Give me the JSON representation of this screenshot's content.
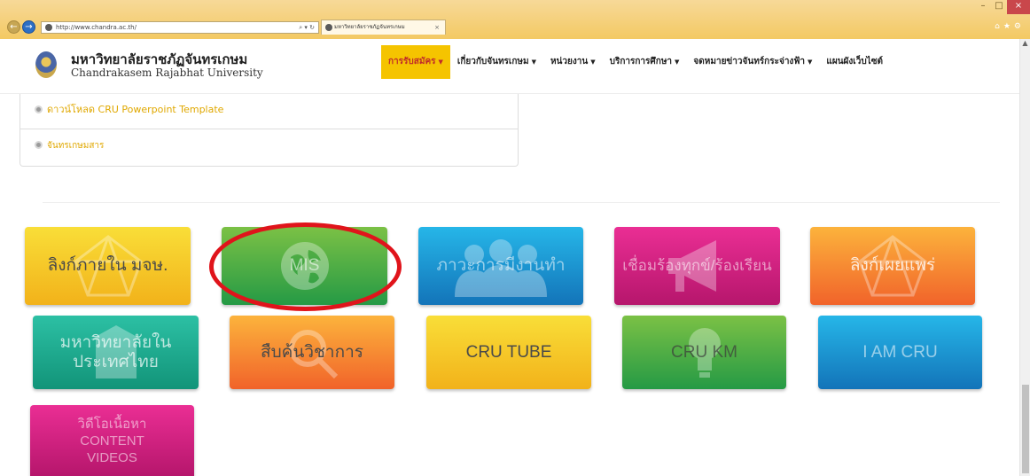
{
  "browser": {
    "url": "http://www.chandra.ac.th/",
    "address_tools": "⌕ ▾ ↻",
    "tab_title": "มหาวิทยาลัยราชภัฏจันทรเกษม",
    "tab_close": "×",
    "minimize": "–",
    "maximize": "□",
    "close": "×",
    "toolbar_icons": "⌂★⚙"
  },
  "header": {
    "brand_th": "มหาวิทยาลัยราชภัฏจันทรเกษม",
    "brand_en": "Chandrakasem Rajabhat University",
    "menu": [
      {
        "label": "การรับสมัคร",
        "caret": "▼"
      },
      {
        "label": "เกี่ยวกับจันทรเกษม",
        "caret": "▼"
      },
      {
        "label": "หน่วยงาน",
        "caret": "▼"
      },
      {
        "label": "บริการการศึกษา",
        "caret": "▼"
      },
      {
        "label": "จดหมายข่าวจันทร์กระจ่างฟ้า",
        "caret": "▼"
      },
      {
        "label": "แผนผังเว็บไซต์"
      }
    ]
  },
  "links": [
    "ดาวน์โหลด CRU Powerpoint Template",
    "จันทรเกษมสาร"
  ],
  "tiles": [
    {
      "label": "ลิงก์ภายใน มจษ.",
      "color": "yellow"
    },
    {
      "label": "MIS",
      "color": "green"
    },
    {
      "label": "ภาวะการมีงานทำ",
      "color": "blue"
    },
    {
      "label": "เชื่อมร้องทุกข์/ร้องเรียน",
      "color": "magenta"
    },
    {
      "label": "ลิงก์เผยแพร่",
      "color": "orange"
    },
    {
      "label": "มหาวิทยาลัยในประเทศไทย",
      "color": "teal"
    },
    {
      "label": "สืบค้นวิชาการ",
      "color": "orange"
    },
    {
      "label": "CRU TUBE",
      "color": "yellow"
    },
    {
      "label": "CRU KM",
      "color": "green"
    },
    {
      "label": "I AM CRU",
      "color": "blue"
    },
    {
      "label": "วิดีโอเนื้อหา CONTENT VIDEOS",
      "color": "magenta"
    }
  ],
  "annotation": {
    "highlighted_tile": "MIS",
    "circle_color": "#e0141b"
  }
}
